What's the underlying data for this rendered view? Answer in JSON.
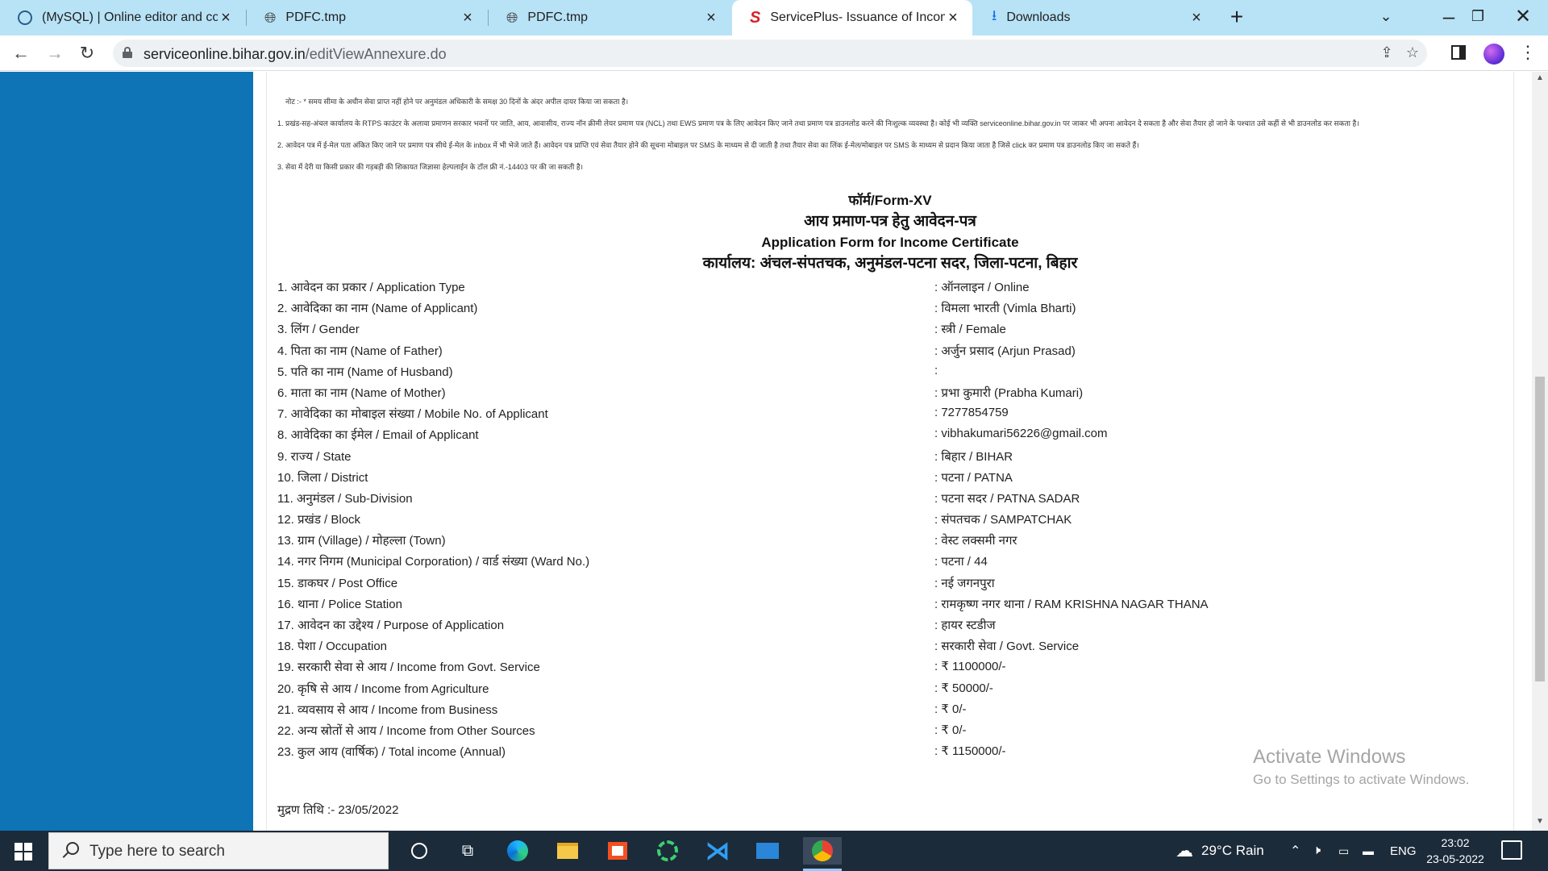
{
  "browser": {
    "tabs": [
      {
        "title": "(MySQL) | Online editor and com",
        "icon": "mysql-icon"
      },
      {
        "title": "PDFC.tmp",
        "icon": "globe-icon"
      },
      {
        "title": "PDFC.tmp",
        "icon": "globe-icon"
      },
      {
        "title": "ServicePlus- Issuance of Income",
        "icon": "serviceplus-icon",
        "active": true
      },
      {
        "title": "Downloads",
        "icon": "download-icon"
      }
    ],
    "url_host": "serviceonline.bihar.gov.in",
    "url_path": "/editViewAnnexure.do"
  },
  "notes": [
    "नोट :- * समय सीमा के अधीन सेवा प्राप्त नहीं होने पर अनुमंडल अधिकारी के समक्ष 30 दिनों के अंदर अपील दायर किया जा सकता है।",
    "1. प्रखंड-सह-अंचल कार्यालय के RTPS काउंटर के अलावा प्रमाणन सरकार भवनों पर जाति, आय, आवासीय, राज्य नॉन क्रीमी लेयर प्रमाण पत्र (NCL) तथा EWS प्रमाण पत्र के लिए आवेदन किए जाने तथा प्रमाण पत्र डाउनलोड करने की निःशुल्क व्यवस्था है। कोई भी व्यक्ति serviceonline.bihar.gov.in पर जाकर भी अपना आवेदन दे सकता है और सेवा तैयार हो जाने के पश्चात उसे कहीं से भी डाउनलोड कर सकता है।",
    "2. आवेदन पत्र में ई-मेल पता अंकित किए जाने पर प्रमाण पत्र सीधे ई-मेल के inbox में भी भेजे जाते हैं। आवेदन पत्र प्राप्ति एवं सेवा तैयार होने की सूचना मोबाइल पर SMS के माध्यम से दी जाती है तथा तैयार सेवा का लिंक ई-मेल/मोबाइल पर SMS के माध्यम से प्रदान किया जाता है जिसे click कर प्रमाण पत्र डाउनलोड किए जा सकते हैं।",
    "3. सेवा में देरी या किसी प्रकार की गड़बड़ी की शिकायत जिज्ञासा हेल्पलाईन के टॉल फ्री नं.-14403 पर की जा सकती है।"
  ],
  "form": {
    "title1": "फॉर्म/Form-XV",
    "title2": "आय प्रमाण-पत्र हेतु आवेदन-पत्र",
    "title3": "Application Form for Income Certificate",
    "title4": "कार्यालय: अंचल-संपतचक, अनुमंडल-पटना सदर, जिला-पटना, बिहार",
    "rows": [
      {
        "label": "1. आवेदन का प्रकार / Application Type",
        "value": ": ऑनलाइन / Online"
      },
      {
        "label": "2. आवेदिका का नाम (Name of Applicant)",
        "value": ": विमला भारती (Vimla Bharti)"
      },
      {
        "label": "3. लिंग / Gender",
        "value": ": स्त्री / Female"
      },
      {
        "label": "4. पिता का नाम (Name of Father)",
        "value": ": अर्जुन प्रसाद (Arjun Prasad)"
      },
      {
        "label": "5. पति का नाम (Name of Husband)",
        "value": ":"
      },
      {
        "label": "6. माता का नाम (Name of Mother)",
        "value": ": प्रभा कुमारी (Prabha Kumari)"
      },
      {
        "label": "7. आवेदिका का मोबाइल संख्या / Mobile No. of Applicant",
        "value": ": 7277854759"
      },
      {
        "label": "8. आवेदिका का ईमेल / Email of Applicant",
        "value": ": vibhakumari56226@gmail.com"
      },
      {
        "label": "9. राज्य / State",
        "value": ": बिहार / BIHAR"
      },
      {
        "label": "10. जिला / District",
        "value": ": पटना / PATNA"
      },
      {
        "label": "11. अनुमंडल / Sub-Division",
        "value": ": पटना सदर / PATNA SADAR"
      },
      {
        "label": "12. प्रखंड / Block",
        "value": ": संपतचक / SAMPATCHAK"
      },
      {
        "label": "13. ग्राम (Village) / मोहल्ला (Town)",
        "value": ": वेस्ट लक्समी नगर"
      },
      {
        "label": "14. नगर निगम (Municipal Corporation) / वार्ड संख्या (Ward No.)",
        "value": ": पटना / 44"
      },
      {
        "label": "15. डाकघर / Post Office",
        "value": ": नई जगनपुरा"
      },
      {
        "label": "16. थाना / Police Station",
        "value": ": रामकृष्ण नगर थाना / RAM KRISHNA NAGAR THANA"
      },
      {
        "label": "17. आवेदन का उद्देश्य / Purpose of Application",
        "value": ": हायर स्टडीज"
      },
      {
        "label": "18. पेशा / Occupation",
        "value": ": सरकारी सेवा / Govt. Service"
      },
      {
        "label": "19. सरकारी सेवा से आय / Income from Govt. Service",
        "value": ": ₹ 1100000/-"
      },
      {
        "label": "20. कृषि से आय / Income from Agriculture",
        "value": ": ₹ 50000/-"
      },
      {
        "label": "21. व्यवसाय से आय / Income from Business",
        "value": ": ₹ 0/-"
      },
      {
        "label": "22. अन्य स्रोतों से आय / Income from Other Sources",
        "value": ": ₹ 0/-"
      },
      {
        "label": "23. कुल आय (वार्षिक) / Total income (Annual)",
        "value": ": ₹ 1150000/-"
      }
    ],
    "print_date": "मुद्रण तिथि :- 23/05/2022"
  },
  "watermark": {
    "line1": "Activate Windows",
    "line2": "Go to Settings to activate Windows."
  },
  "taskbar": {
    "search_placeholder": "Type here to search",
    "weather": "29°C  Rain",
    "language": "ENG",
    "time": "23:02",
    "date": "23-05-2022"
  },
  "colors": {
    "tabstrip": "#b8e3f6",
    "sidebar_blue": "#0e74b6",
    "taskbar": "#1c2b3a"
  }
}
